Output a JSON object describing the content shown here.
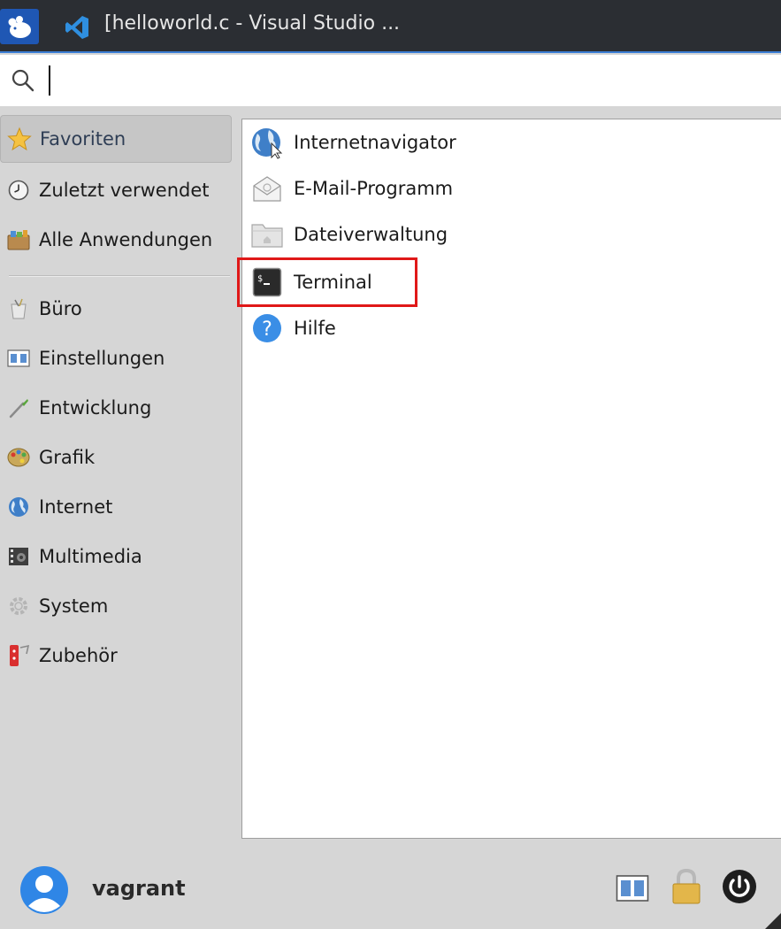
{
  "taskbar": {
    "task_title": "[helloworld.c - Visual Studio ..."
  },
  "search": {
    "value": "",
    "placeholder": ""
  },
  "categories": [
    {
      "label": "Favoriten",
      "icon": "star-icon",
      "active": true
    },
    {
      "label": "Zuletzt verwendet",
      "icon": "clock-icon"
    },
    {
      "label": "Alle Anwendungen",
      "icon": "applications-icon"
    },
    {
      "label": "Büro",
      "icon": "office-icon"
    },
    {
      "label": "Einstellungen",
      "icon": "settings-icon"
    },
    {
      "label": "Entwicklung",
      "icon": "development-icon"
    },
    {
      "label": "Grafik",
      "icon": "graphics-icon"
    },
    {
      "label": "Internet",
      "icon": "globe-icon"
    },
    {
      "label": "Multimedia",
      "icon": "multimedia-icon"
    },
    {
      "label": "System",
      "icon": "gear-icon"
    },
    {
      "label": "Zubehör",
      "icon": "accessories-icon"
    }
  ],
  "favorites": [
    {
      "label": "Internetnavigator",
      "icon": "web-browser-icon"
    },
    {
      "label": "E-Mail-Programm",
      "icon": "mail-icon"
    },
    {
      "label": "Dateiverwaltung",
      "icon": "folder-icon"
    },
    {
      "label": "Terminal",
      "icon": "terminal-icon",
      "highlighted": true
    },
    {
      "label": "Hilfe",
      "icon": "help-icon"
    }
  ],
  "user": {
    "name": "vagrant"
  },
  "actions": [
    {
      "name": "settings-manager",
      "icon": "settings-manager-icon"
    },
    {
      "name": "lock-screen",
      "icon": "lock-icon"
    },
    {
      "name": "log-out",
      "icon": "power-icon"
    }
  ],
  "colors": {
    "taskbar": "#2b2e33",
    "accent": "#3d7fd6",
    "highlight_box": "#e01818",
    "menu_background": "#d6d6d6"
  }
}
